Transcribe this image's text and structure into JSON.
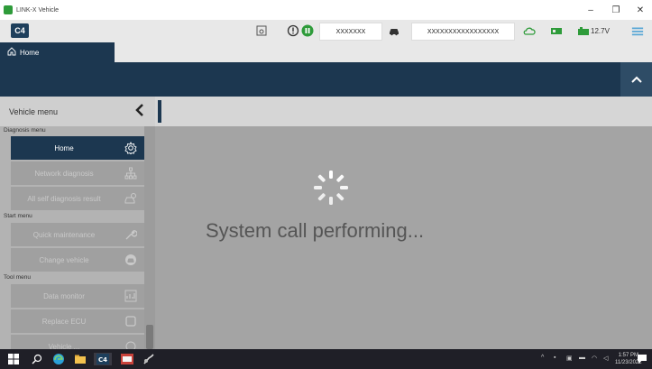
{
  "window": {
    "title": "LINK-X Vehicle",
    "minimize_symbol": "–",
    "restore_symbol": "❐",
    "close_symbol": "✕"
  },
  "toolbar": {
    "logo": "C4",
    "vehicle_code": "XXXXXXX",
    "vin": "XXXXXXXXXXXXXXXXX",
    "voltage": "12.7V",
    "icons": [
      "screenshot-icon",
      "alert-icon",
      "pause-icon",
      "car-icon",
      "cloud-icon",
      "battery-icon",
      "plug-icon",
      "menu-icon"
    ]
  },
  "tabs": {
    "home_label": "Home"
  },
  "sidebar": {
    "header": "Vehicle menu",
    "sections": [
      {
        "title": "Diagnosis menu",
        "items": [
          {
            "label": "Home",
            "icon": "gear-icon",
            "active": true
          },
          {
            "label": "Network diagnosis",
            "icon": "network-icon",
            "active": false
          },
          {
            "label": "All self diagnosis result",
            "icon": "car-diagnosis-icon",
            "active": false
          }
        ]
      },
      {
        "title": "Start menu",
        "items": [
          {
            "label": "Quick maintenance",
            "icon": "wrench-icon",
            "active": false
          },
          {
            "label": "Change vehicle",
            "icon": "vehicle-icon",
            "active": false
          }
        ]
      },
      {
        "title": "Tool menu",
        "items": [
          {
            "label": "Data monitor",
            "icon": "chart-icon",
            "active": false
          },
          {
            "label": "Replace ECU",
            "icon": "ecu-icon",
            "active": false
          },
          {
            "label": "Vehicle ...",
            "icon": "settings-icon",
            "active": false
          }
        ]
      }
    ]
  },
  "main": {
    "status_text": "System call performing..."
  },
  "taskbar": {
    "time": "1:57 PM",
    "date": "11/23/2022",
    "apps": [
      "start-icon",
      "search-icon",
      "edge-icon",
      "file-explorer-icon",
      "c4-app-icon",
      "diag-app-icon",
      "tool-app-icon"
    ]
  },
  "colors": {
    "navy": "#1c3750",
    "sidebar_bg": "#b3b3b3",
    "main_overlay": "#a4a4a4",
    "accent_green": "#2e9b3a"
  }
}
